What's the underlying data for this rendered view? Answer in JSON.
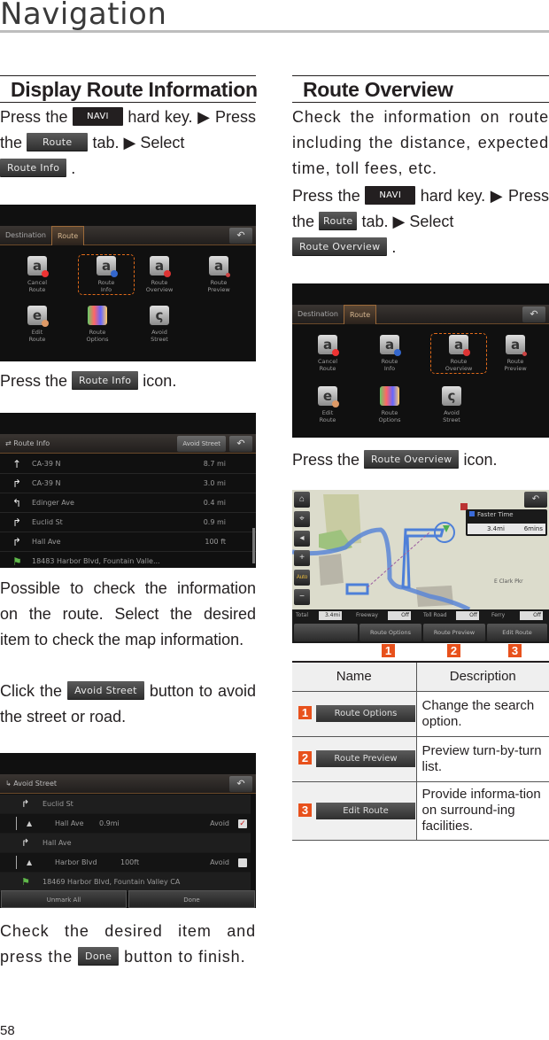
{
  "page": {
    "title": "Navigation",
    "number": "58"
  },
  "left": {
    "heading": "Display Route Information",
    "intro": {
      "t1": "Press  the ",
      "navi_key": "NAVI",
      "t2": " hard key. ▶ Press the ",
      "route_tab": "Route",
      "t3": " tab. ▶ Select ",
      "route_info_key": "Route Info",
      "t4": " ."
    },
    "route_menu_screen": {
      "tabs": [
        "Destination",
        "Route"
      ],
      "back_icon": "back-arrow-icon",
      "items": [
        {
          "label1": "Cancel",
          "label2": "Route",
          "icon": "cancel-route-icon",
          "selected": false
        },
        {
          "label1": "Route",
          "label2": "Info",
          "icon": "route-info-icon",
          "selected": true
        },
        {
          "label1": "Route",
          "label2": "Overview",
          "icon": "route-overview-icon",
          "selected": false
        },
        {
          "label1": "Route",
          "label2": "Preview",
          "icon": "route-preview-icon",
          "selected": false
        },
        {
          "label1": "Edit",
          "label2": "Route",
          "icon": "edit-route-icon",
          "selected": false
        },
        {
          "label1": "Route",
          "label2": "Options",
          "icon": "route-options-icon",
          "selected": false
        },
        {
          "label1": "Avoid",
          "label2": "Street",
          "icon": "avoid-street-icon",
          "selected": false
        }
      ]
    },
    "press_info": {
      "t1": "Press the ",
      "key": "Route Info",
      "t2": " icon."
    },
    "route_info_screen": {
      "title": "Route Info",
      "avoid_button": "Avoid Street",
      "rows": [
        {
          "turn": "fork-icon",
          "street": "CA-39 N",
          "distance": "8.7 mi"
        },
        {
          "turn": "turn-right-icon",
          "street": "CA-39 N",
          "distance": "3.0 mi"
        },
        {
          "turn": "turn-left-icon",
          "street": "Edinger Ave",
          "distance": "0.4 mi"
        },
        {
          "turn": "turn-right-icon",
          "street": "Euclid St",
          "distance": "0.9 mi"
        },
        {
          "turn": "turn-right-icon",
          "street": "Hall Ave",
          "distance": "100 ft"
        },
        {
          "turn": "destination-flag-icon",
          "street": "18483 Harbor Blvd, Fountain Valle...",
          "distance": ""
        }
      ]
    },
    "para1": "Possible to check the information on the route.  Select the desired item to check the map information.",
    "para2": {
      "t1": "Click the ",
      "key": "Avoid Street",
      "t2": " button to avoid the street or road."
    },
    "avoid_screen": {
      "title": "Avoid Street",
      "rows": [
        {
          "type": "group",
          "street": "Euclid St"
        },
        {
          "type": "sub",
          "street": "Hall Ave",
          "distance": "0.9mi",
          "avoid_label": "Avoid",
          "checked": true
        },
        {
          "type": "group",
          "street": "Hall Ave"
        },
        {
          "type": "sub",
          "street": "Harbor Blvd",
          "distance": "100ft",
          "avoid_label": "Avoid",
          "checked": false
        },
        {
          "type": "dest",
          "street": "18469 Harbor Blvd, Fountain Valley CA"
        }
      ],
      "unmark_all": "Unmark All",
      "done": "Done"
    },
    "para3": {
      "t1": "Check the desired item and press the ",
      "key": "Done",
      "t2": " button to finish."
    }
  },
  "right": {
    "heading": "Route Overview",
    "para1": "Check the information on route including the distance, expected time, toll fees, etc.",
    "intro": {
      "t1": "Press  the ",
      "navi_key": "NAVI",
      "t2": " hard key. ▶ Press the ",
      "route_tab": "Route",
      "t3": " tab. ▶ Select ",
      "overview_key": "Route Overview",
      "t4": " ."
    },
    "route_menu_screen": {
      "tabs": [
        "Destination",
        "Route"
      ],
      "selected_item": "Route Overview"
    },
    "press_overview": {
      "t1": "Press the ",
      "key": "Route Overview",
      "t2": " icon."
    },
    "map_screen": {
      "side_buttons": [
        "home-icon",
        "compass-icon",
        "volume-icon",
        "zoom-in-icon",
        "auto-icon",
        "zoom-out-icon"
      ],
      "auto_label": "Auto",
      "info_title": "Faster Time",
      "info_distance": "3.4mi",
      "info_time": "6mins",
      "place_label": "E Clark Pkr",
      "status": [
        {
          "label": "Total",
          "value": "3.4mi"
        },
        {
          "label": "Freeway",
          "value": "Off"
        },
        {
          "label": "Toll Road",
          "value": "Off"
        },
        {
          "label": "Ferry",
          "value": "Off"
        }
      ],
      "buttons": [
        "",
        "Route Options",
        "Route Preview",
        "Edit Route"
      ],
      "callouts": [
        "1",
        "2",
        "3"
      ]
    },
    "table": {
      "headers": [
        "Name",
        "Description"
      ],
      "rows": [
        {
          "num": "1",
          "key": "Route Options",
          "desc": "Change the search option."
        },
        {
          "num": "2",
          "key": "Route Preview",
          "desc": "Preview turn-by-turn list."
        },
        {
          "num": "3",
          "key": "Edit Route",
          "desc": "Provide informa-tion on surround-ing facilities."
        }
      ]
    }
  },
  "colors": {
    "accent": "#e8511c",
    "key_dark": "#231f20",
    "rule": "#bdbdbd"
  }
}
